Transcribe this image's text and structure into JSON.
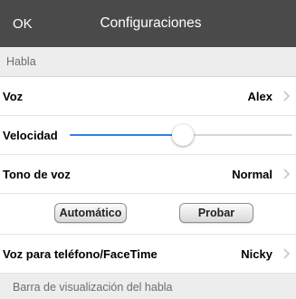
{
  "nav": {
    "ok_label": "OK",
    "title": "Configuraciones"
  },
  "section_header": "Habla",
  "rows": {
    "voice": {
      "label": "Voz",
      "value": "Alex"
    },
    "speed": {
      "label": "Velocidad",
      "value_fraction": 0.51
    },
    "tone": {
      "label": "Tono de voz",
      "value": "Normal"
    },
    "phone_voice": {
      "label": "Voz para teléfono/FaceTime",
      "value": "Nicky"
    }
  },
  "buttons": {
    "automatic": "Automático",
    "test": "Probar"
  },
  "section_footer": "Barra de visualización del habla",
  "colors": {
    "nav_bg": "#4a4a4a",
    "slider_fill": "#2f7fe5"
  }
}
